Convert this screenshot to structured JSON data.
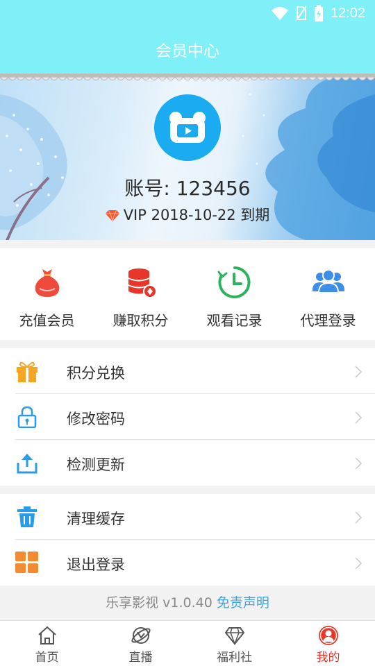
{
  "status_bar": {
    "time": "12:02"
  },
  "app_bar": {
    "title": "会员中心"
  },
  "profile": {
    "account_text": "账号: 123456",
    "vip_text": "VIP 2018-10-22 到期"
  },
  "quick_actions": [
    {
      "label": "充值会员",
      "icon": "money-bag-icon"
    },
    {
      "label": "赚取积分",
      "icon": "coin-stack-icon"
    },
    {
      "label": "观看记录",
      "icon": "clock-icon"
    },
    {
      "label": "代理登录",
      "icon": "group-users-icon"
    }
  ],
  "menu_group_1": [
    {
      "label": "积分兑换",
      "icon": "gift-icon"
    },
    {
      "label": "修改密码",
      "icon": "lock-icon"
    },
    {
      "label": "检测更新",
      "icon": "upload-icon"
    }
  ],
  "menu_group_2": [
    {
      "label": "清理缓存",
      "icon": "trash-icon"
    },
    {
      "label": "退出登录",
      "icon": "grid-icon"
    }
  ],
  "footer": {
    "version_text": "乐享影视 v1.0.40",
    "disclaimer_link": "免责声明"
  },
  "tab_bar": [
    {
      "label": "首页",
      "icon": "home-icon"
    },
    {
      "label": "直播",
      "icon": "planet-icon"
    },
    {
      "label": "福利社",
      "icon": "diamond-icon"
    },
    {
      "label": "我的",
      "icon": "user-icon",
      "active": true
    }
  ],
  "colors": {
    "header": "#7ff0f8",
    "accent_blue": "#1aabf0",
    "active_tab": "#e8362a",
    "link": "#3ba7e6"
  }
}
